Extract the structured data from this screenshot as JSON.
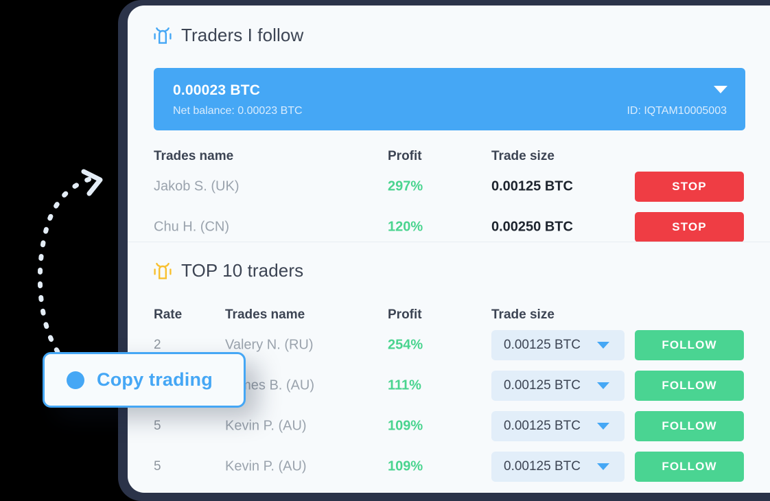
{
  "colors": {
    "accent_blue": "#45a7f5",
    "green": "#4ad492",
    "red": "#ef3d44",
    "trophy_yellow": "#f8c02f",
    "frame_navy": "#2b3349",
    "card_bg": "#f7fafc",
    "dropdown_bg": "#e2eef9"
  },
  "followed_section": {
    "icon": "trophy-icon",
    "title": "Traders I follow",
    "balance": {
      "amount": "0.00023 BTC",
      "net_balance": "Net balance: 0.00023 BTC",
      "account_id": "ID: IQTAM10005003",
      "caret": "chevron-down-icon"
    },
    "headers": {
      "name": "Trades name",
      "profit": "Profit",
      "size": "Trade size"
    },
    "rows": [
      {
        "name": "Jakob S. (UK)",
        "profit": "297%",
        "size": "0.00125 BTC",
        "action": "STOP"
      },
      {
        "name": "Chu H. (CN)",
        "profit": "120%",
        "size": "0.00250 BTC",
        "action": "STOP"
      }
    ]
  },
  "top10_section": {
    "icon": "trophy-icon",
    "title": "TOP 10 traders",
    "headers": {
      "rate": "Rate",
      "name": "Trades name",
      "profit": "Profit",
      "size": "Trade size"
    },
    "rows": [
      {
        "rate": "2",
        "name": "Valery N. (RU)",
        "profit": "254%",
        "size": "0.00125 BTC",
        "action": "FOLLOW"
      },
      {
        "rate": "",
        "name": "James B. (AU)",
        "profit": "111%",
        "size": "0.00125 BTC",
        "action": "FOLLOW"
      },
      {
        "rate": "5",
        "name": "Kevin P. (AU)",
        "profit": "109%",
        "size": "0.00125 BTC",
        "action": "FOLLOW"
      },
      {
        "rate": "5",
        "name": "Kevin P. (AU)",
        "profit": "109%",
        "size": "0.00125 BTC",
        "action": "FOLLOW"
      }
    ]
  },
  "callout": {
    "label": "Copy trading",
    "dot": "bullet-dot-icon",
    "arrow": "curved-dashed-arrow-icon"
  }
}
